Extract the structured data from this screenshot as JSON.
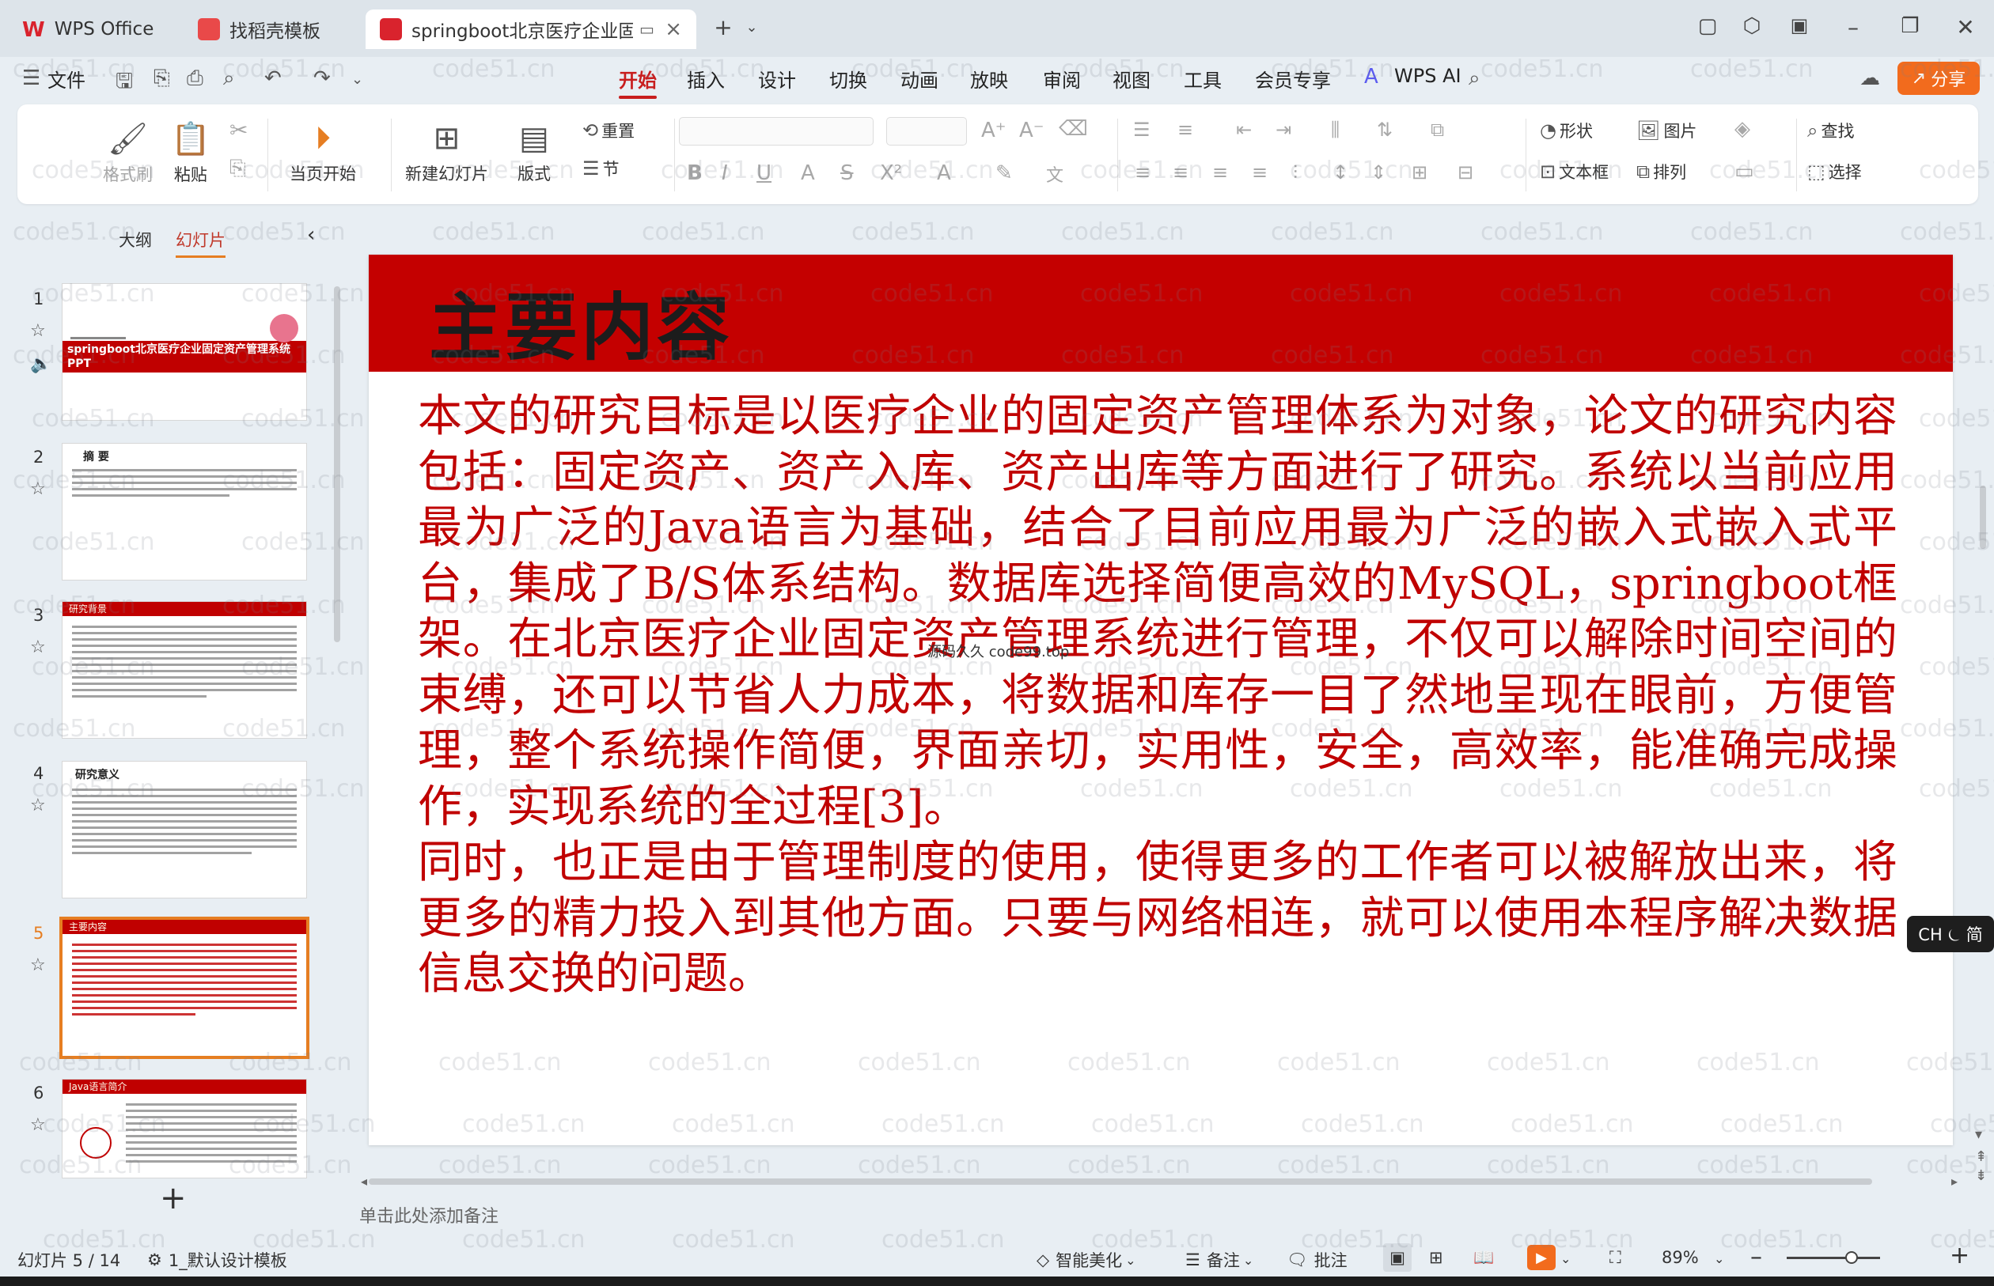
{
  "tabs": [
    {
      "label": "WPS Office",
      "color": "#d9232d"
    },
    {
      "label": "找稻壳模板",
      "color": "#e94949"
    },
    {
      "label": "springboot北京医疗企业固定",
      "color": "#d9232d",
      "active": true
    }
  ],
  "menu": {
    "file_label": "文件",
    "items": [
      "开始",
      "插入",
      "设计",
      "切换",
      "动画",
      "放映",
      "审阅",
      "视图",
      "工具",
      "会员专享",
      "WPS AI"
    ],
    "active": "开始",
    "share_label": "分享"
  },
  "ribbon": {
    "format_painter": "格式刷",
    "paste": "粘贴",
    "from_current": "当页开始",
    "new_slide": "新建幻灯片",
    "layout": "版式",
    "reset": "重置",
    "section": "节",
    "shape": "形状",
    "picture": "图片",
    "textbox": "文本框",
    "arrange": "排列",
    "find": "查找",
    "select": "选择"
  },
  "left_panel": {
    "tab_outline": "大纲",
    "tab_slides": "幻灯片",
    "slides": [
      {
        "num": "1",
        "title": "springboot北京医疗企业固定资产管理系统PPT"
      },
      {
        "num": "2",
        "title": "摘 要"
      },
      {
        "num": "3",
        "title": "研究背景"
      },
      {
        "num": "4",
        "title": "研究意义"
      },
      {
        "num": "5",
        "title": "主要内容"
      },
      {
        "num": "6",
        "title": "Java语言简介"
      }
    ],
    "selected": 5
  },
  "slide": {
    "title": "主要内容",
    "para1": "本文的研究目标是以医疗企业的固定资产管理体系为对象，论文的研究内容包括：固定资产、资产入库、资产出库等方面进行了研究。系统以当前应用最为广泛的Java语言为基础，结合了目前应用最为广泛的嵌入式嵌入式平台，集成了B/S体系结构。数据库选择简便高效的MySQL，springboot框架。在北京医疗企业固定资产管理系统进行管理，不仅可以解除时间空间的束缚，还可以节省人力成本，将数据和库存一目了然地呈现在眼前，方便管理，整个系统操作简便，界面亲切，实用性，安全，高效率，能准确完成操作，实现系统的全过程[3]。",
    "para2": "同时，也正是由于管理制度的使用，使得更多的工作者可以被解放出来，将更多的精力投入到其他方面。只要与网络相连，就可以使用本程序解决数据信息交换的问题。",
    "watermark": "源码久久 code99.top",
    "title_bar_color": "#c40000",
    "text_color": "#c00000"
  },
  "notes_placeholder": "单击此处添加备注",
  "ime": "CH ⏾ 简",
  "status": {
    "slide_counter": "幻灯片 5 / 14",
    "template": "1_默认设计模板",
    "smart_beautify": "智能美化",
    "notes": "备注",
    "comments": "批注",
    "zoom": "89%"
  },
  "watermark_text": "code51.cn"
}
